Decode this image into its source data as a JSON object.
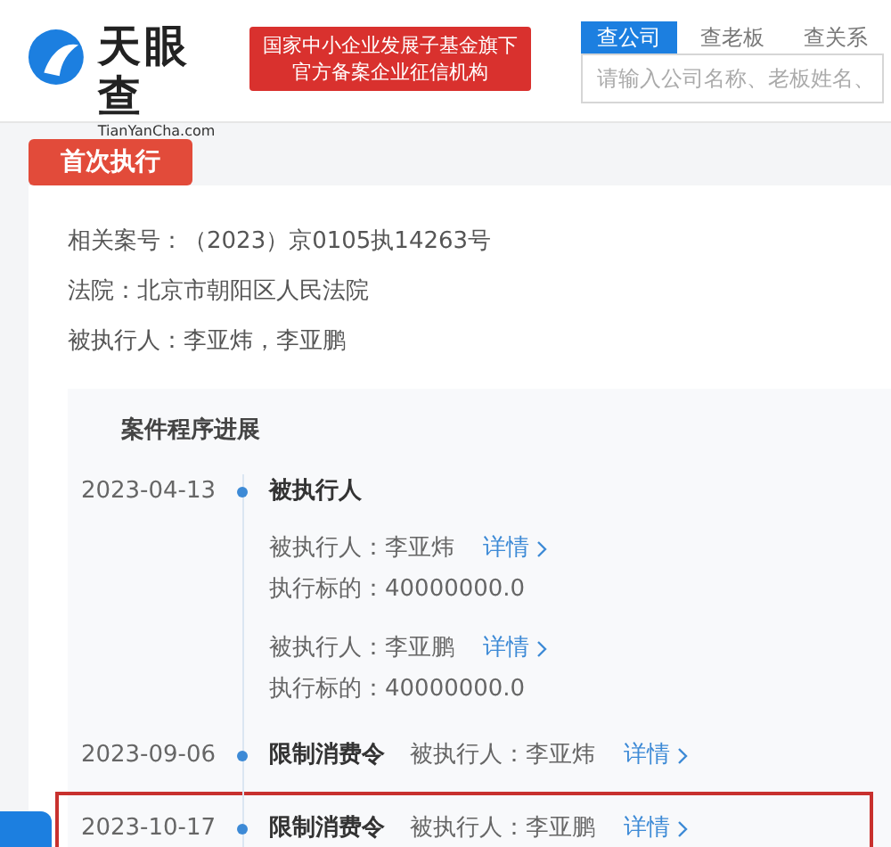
{
  "header": {
    "logo": {
      "name": "天眼查",
      "domain": "TianYanCha.com"
    },
    "badge_lines": [
      "国家中小企业发展子基金旗下",
      "官方备案企业征信机构"
    ],
    "search_tabs": [
      {
        "label": "查公司",
        "selected": true
      },
      {
        "label": "查老板",
        "selected": false
      },
      {
        "label": "查关系",
        "selected": false
      }
    ],
    "search": {
      "placeholder": "请输入公司名称、老板姓名、"
    }
  },
  "section_tag": "首次执行",
  "fields": [
    {
      "label": "相关案号：",
      "value": "（2023）京0105执14263号"
    },
    {
      "label": "法院：",
      "value": "北京市朝阳区人民法院"
    },
    {
      "label": "被执行人：",
      "value": "李亚炜，李亚鹏"
    }
  ],
  "progress": {
    "title": "案件程序进展",
    "entries": [
      {
        "kind": "block",
        "date": "2023-04-13",
        "title": "被执行人",
        "highlighted": false,
        "details": [
          {
            "label": "被执行人：",
            "name": "李亚炜",
            "link": "详情",
            "amount_label": "执行标的：",
            "amount": "40000000.0"
          },
          {
            "label": "被执行人：",
            "name": "李亚鹏",
            "link": "详情",
            "amount_label": "执行标的：",
            "amount": "40000000.0"
          }
        ]
      },
      {
        "kind": "inline",
        "date": "2023-09-06",
        "title": "限制消费令",
        "highlighted": false,
        "label": "被执行人：",
        "name": "李亚炜",
        "link": "详情"
      },
      {
        "kind": "inline",
        "date": "2023-10-17",
        "title": "限制消费令",
        "highlighted": true,
        "label": "被执行人：",
        "name": "李亚鹏",
        "link": "详情"
      }
    ]
  }
}
